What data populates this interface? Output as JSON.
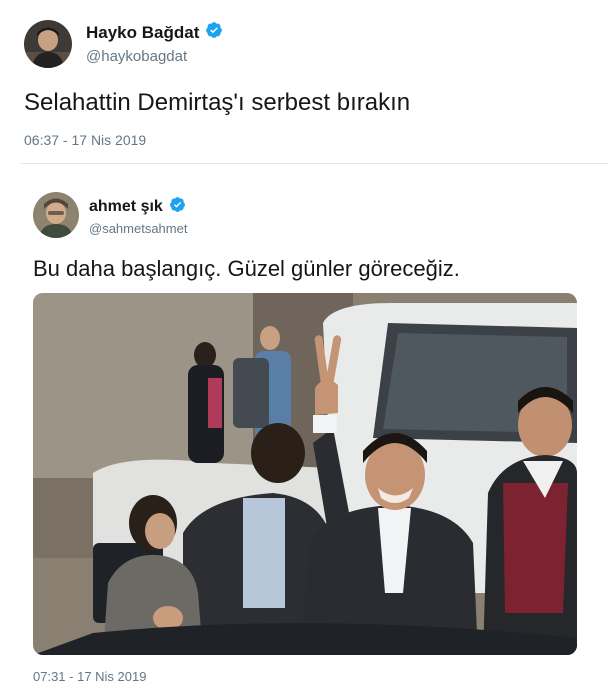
{
  "top_tweet": {
    "display_name": "Hayko Bağdat",
    "handle": "@haykobagdat",
    "text": "Selahattin Demirtaş'ı serbest bırakın",
    "timestamp": "06:37 - 17 Nis 2019",
    "verified_icon": "verified-badge-icon"
  },
  "quoted_tweet": {
    "display_name": "ahmet şık",
    "handle": "@sahmetsahmet",
    "text": "Bu daha başlangıç. Güzel günler göreceğiz.",
    "timestamp": "07:31 - 17 Nis 2019",
    "verified_icon": "verified-badge-icon",
    "media": "photo"
  },
  "colors": {
    "verified_blue": "#1da1f2",
    "secondary_text": "#657786",
    "divider": "#e1e8ed"
  }
}
